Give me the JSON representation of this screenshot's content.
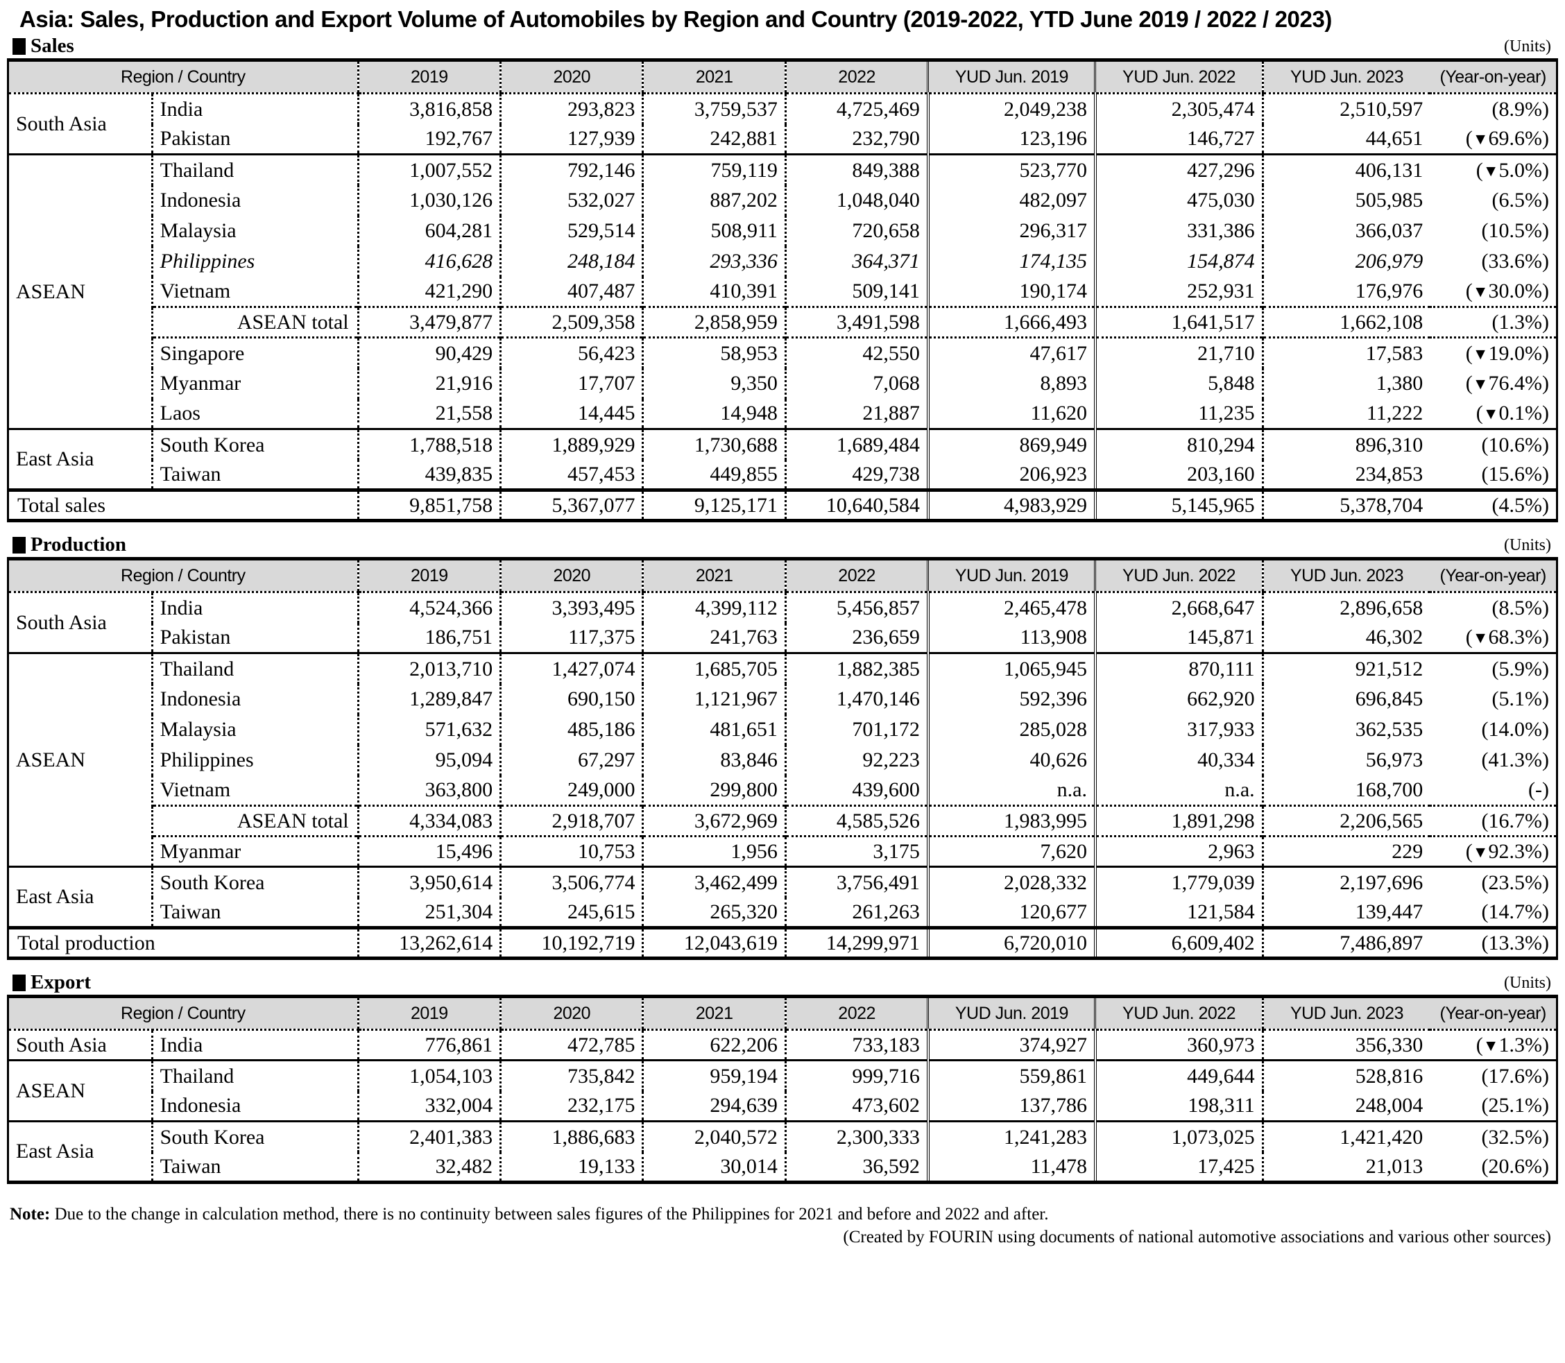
{
  "title": "Asia: Sales, Production and Export Volume of Automobiles by Region and Country (2019-2022, YTD June 2019 / 2022 / 2023)",
  "units_label": "(Units)",
  "columns": [
    "Region / Country",
    "2019",
    "2020",
    "2021",
    "2022",
    "YUD Jun. 2019",
    "YUD Jun. 2022",
    "YUD Jun. 2023",
    "(Year-on-year)"
  ],
  "sections": [
    {
      "name": "Sales",
      "total_label": "Total sales",
      "total": [
        "9,851,758",
        "5,367,077",
        "9,125,171",
        "10,640,584",
        "4,983,929",
        "5,145,965",
        "5,378,704",
        "(4.5%)"
      ],
      "rows": [
        {
          "region": "South Asia",
          "region_rowspan": 2,
          "country": "India",
          "sep": "solid",
          "values": [
            "3,816,858",
            "293,823",
            "3,759,537",
            "4,725,469",
            "2,049,238",
            "2,305,474",
            "2,510,597"
          ],
          "yoy": "(8.9%)"
        },
        {
          "region": "",
          "country": "Pakistan",
          "values": [
            "192,767",
            "127,939",
            "242,881",
            "232,790",
            "123,196",
            "146,727",
            "44,651"
          ],
          "yoy": "(▼69.6%)"
        },
        {
          "region": "ASEAN",
          "region_rowspan": 9,
          "country": "Thailand",
          "sep": "solid",
          "values": [
            "1,007,552",
            "792,146",
            "759,119",
            "849,388",
            "523,770",
            "427,296",
            "406,131"
          ],
          "yoy": "(▼5.0%)"
        },
        {
          "region": "",
          "country": "Indonesia",
          "values": [
            "1,030,126",
            "532,027",
            "887,202",
            "1,048,040",
            "482,097",
            "475,030",
            "505,985"
          ],
          "yoy": "(6.5%)"
        },
        {
          "region": "",
          "country": "Malaysia",
          "values": [
            "604,281",
            "529,514",
            "508,911",
            "720,658",
            "296,317",
            "331,386",
            "366,037"
          ],
          "yoy": "(10.5%)"
        },
        {
          "region": "",
          "country": "Philippines",
          "italic": true,
          "values": [
            "416,628",
            "248,184",
            "293,336",
            "364,371",
            "174,135",
            "154,874",
            "206,979"
          ],
          "yoy": "(33.6%)"
        },
        {
          "region": "",
          "country": "Vietnam",
          "values": [
            "421,290",
            "407,487",
            "410,391",
            "509,141",
            "190,174",
            "252,931",
            "176,976"
          ],
          "yoy": "(▼30.0%)"
        },
        {
          "region": "",
          "country": "ASEAN total",
          "total_sub": true,
          "sep": "dotted",
          "values": [
            "3,479,877",
            "2,509,358",
            "2,858,959",
            "3,491,598",
            "1,666,493",
            "1,641,517",
            "1,662,108"
          ],
          "yoy": "(1.3%)"
        },
        {
          "region": "",
          "country": "Singapore",
          "sep": "dotted",
          "values": [
            "90,429",
            "56,423",
            "58,953",
            "42,550",
            "47,617",
            "21,710",
            "17,583"
          ],
          "yoy": "(▼19.0%)"
        },
        {
          "region": "",
          "country": "Myanmar",
          "values": [
            "21,916",
            "17,707",
            "9,350",
            "7,068",
            "8,893",
            "5,848",
            "1,380"
          ],
          "yoy": "(▼76.4%)"
        },
        {
          "region": "",
          "country": "Laos",
          "values": [
            "21,558",
            "14,445",
            "14,948",
            "21,887",
            "11,620",
            "11,235",
            "11,222"
          ],
          "yoy": "(▼0.1%)"
        },
        {
          "region": "East Asia",
          "region_rowspan": 2,
          "country": "South Korea",
          "sep": "solid",
          "values": [
            "1,788,518",
            "1,889,929",
            "1,730,688",
            "1,689,484",
            "869,949",
            "810,294",
            "896,310"
          ],
          "yoy": "(10.6%)"
        },
        {
          "region": "",
          "country": "Taiwan",
          "values": [
            "439,835",
            "457,453",
            "449,855",
            "429,738",
            "206,923",
            "203,160",
            "234,853"
          ],
          "yoy": "(15.6%)"
        }
      ]
    },
    {
      "name": "Production",
      "total_label": "Total production",
      "total": [
        "13,262,614",
        "10,192,719",
        "12,043,619",
        "14,299,971",
        "6,720,010",
        "6,609,402",
        "7,486,897",
        "(13.3%)"
      ],
      "rows": [
        {
          "region": "South Asia",
          "region_rowspan": 2,
          "country": "India",
          "sep": "solid",
          "values": [
            "4,524,366",
            "3,393,495",
            "4,399,112",
            "5,456,857",
            "2,465,478",
            "2,668,647",
            "2,896,658"
          ],
          "yoy": "(8.5%)"
        },
        {
          "region": "",
          "country": "Pakistan",
          "values": [
            "186,751",
            "117,375",
            "241,763",
            "236,659",
            "113,908",
            "145,871",
            "46,302"
          ],
          "yoy": "(▼68.3%)"
        },
        {
          "region": "ASEAN",
          "region_rowspan": 7,
          "country": "Thailand",
          "sep": "solid",
          "values": [
            "2,013,710",
            "1,427,074",
            "1,685,705",
            "1,882,385",
            "1,065,945",
            "870,111",
            "921,512"
          ],
          "yoy": "(5.9%)"
        },
        {
          "region": "",
          "country": "Indonesia",
          "values": [
            "1,289,847",
            "690,150",
            "1,121,967",
            "1,470,146",
            "592,396",
            "662,920",
            "696,845"
          ],
          "yoy": "(5.1%)"
        },
        {
          "region": "",
          "country": "Malaysia",
          "values": [
            "571,632",
            "485,186",
            "481,651",
            "701,172",
            "285,028",
            "317,933",
            "362,535"
          ],
          "yoy": "(14.0%)"
        },
        {
          "region": "",
          "country": "Philippines",
          "values": [
            "95,094",
            "67,297",
            "83,846",
            "92,223",
            "40,626",
            "40,334",
            "56,973"
          ],
          "yoy": "(41.3%)"
        },
        {
          "region": "",
          "country": "Vietnam",
          "values": [
            "363,800",
            "249,000",
            "299,800",
            "439,600",
            "n.a.",
            "n.a.",
            "168,700"
          ],
          "yoy": "(-)"
        },
        {
          "region": "",
          "country": "ASEAN total",
          "total_sub": true,
          "sep": "dotted",
          "values": [
            "4,334,083",
            "2,918,707",
            "3,672,969",
            "4,585,526",
            "1,983,995",
            "1,891,298",
            "2,206,565"
          ],
          "yoy": "(16.7%)"
        },
        {
          "region": "",
          "country": "Myanmar",
          "sep": "dotted",
          "values": [
            "15,496",
            "10,753",
            "1,956",
            "3,175",
            "7,620",
            "2,963",
            "229"
          ],
          "yoy": "(▼92.3%)"
        },
        {
          "region": "East Asia",
          "region_rowspan": 2,
          "country": "South Korea",
          "sep": "solid",
          "values": [
            "3,950,614",
            "3,506,774",
            "3,462,499",
            "3,756,491",
            "2,028,332",
            "1,779,039",
            "2,197,696"
          ],
          "yoy": "(23.5%)"
        },
        {
          "region": "",
          "country": "Taiwan",
          "values": [
            "251,304",
            "245,615",
            "265,320",
            "261,263",
            "120,677",
            "121,584",
            "139,447"
          ],
          "yoy": "(14.7%)"
        }
      ]
    },
    {
      "name": "Export",
      "total_label": "",
      "total": [],
      "rows": [
        {
          "region": "South Asia",
          "region_rowspan": 1,
          "country": "India",
          "sep": "solid",
          "values": [
            "776,861",
            "472,785",
            "622,206",
            "733,183",
            "374,927",
            "360,973",
            "356,330"
          ],
          "yoy": "(▼1.3%)"
        },
        {
          "region": "ASEAN",
          "region_rowspan": 2,
          "country": "Thailand",
          "sep": "solid",
          "values": [
            "1,054,103",
            "735,842",
            "959,194",
            "999,716",
            "559,861",
            "449,644",
            "528,816"
          ],
          "yoy": "(17.6%)"
        },
        {
          "region": "",
          "country": "Indonesia",
          "values": [
            "332,004",
            "232,175",
            "294,639",
            "473,602",
            "137,786",
            "198,311",
            "248,004"
          ],
          "yoy": "(25.1%)"
        },
        {
          "region": "East Asia",
          "region_rowspan": 2,
          "country": "South Korea",
          "sep": "solid",
          "values": [
            "2,401,383",
            "1,886,683",
            "2,040,572",
            "2,300,333",
            "1,241,283",
            "1,073,025",
            "1,421,420"
          ],
          "yoy": "(32.5%)"
        },
        {
          "region": "",
          "country": "Taiwan",
          "values": [
            "32,482",
            "19,133",
            "30,014",
            "36,592",
            "11,478",
            "17,425",
            "21,013"
          ],
          "yoy": "(20.6%)"
        }
      ]
    }
  ],
  "notes": {
    "label": "Note:",
    "text": "Due to the change in calculation method, there is no continuity between sales figures of the Philippines for 2021 and before and 2022 and after.",
    "credit": "(Created by FOURIN using documents of national automotive associations and various other sources)"
  }
}
